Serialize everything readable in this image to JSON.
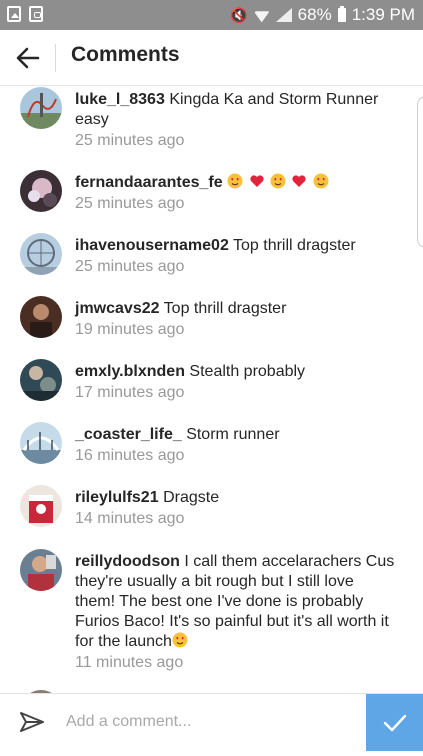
{
  "status_bar": {
    "battery": "68%",
    "time": "1:39 PM"
  },
  "header": {
    "title": "Comments"
  },
  "comments": [
    {
      "username": "luke_l_8363",
      "text": "Kingda Ka and Storm Runner easy",
      "time": "25 minutes ago"
    },
    {
      "username": "fernandaarantes_fe",
      "text": "",
      "emojis": [
        "heart-eyes",
        "red-heart",
        "heart-eyes",
        "red-heart",
        "heart-eyes"
      ],
      "time": "25 minutes ago"
    },
    {
      "username": "ihavenousername02",
      "text": "Top thrill dragster",
      "time": "25 minutes ago"
    },
    {
      "username": "jmwcavs22",
      "text": "Top thrill dragster",
      "time": "19 minutes ago"
    },
    {
      "username": "emxly.blxnden",
      "text": "Stealth probably",
      "time": "17 minutes ago"
    },
    {
      "username": "_coaster_life_",
      "text": "Storm runner",
      "time": "16 minutes ago"
    },
    {
      "username": "rileylulfs21",
      "text": "Dragste",
      "time": "14 minutes ago"
    },
    {
      "username": "reillydoodson",
      "text": "I call them accelarachers Cus they're usually a bit rough but I still love them! The best one I've done is probably Furios Baco! It's so painful but it's all worth it for the launch",
      "emojis": [
        "heart-eyes"
      ],
      "time": "11 minutes ago"
    }
  ],
  "input": {
    "placeholder": "Add a comment..."
  },
  "colors": {
    "accent": "#5ea6e6",
    "status_bar": "#8e8e8e",
    "meta_text": "#999999"
  }
}
